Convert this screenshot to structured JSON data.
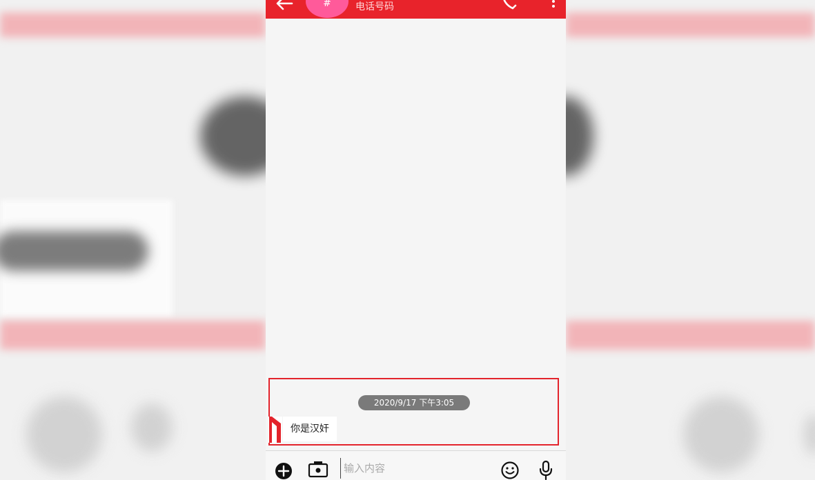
{
  "header": {
    "avatar_text": "#",
    "contact_subtitle": "电话号码"
  },
  "chat": {
    "messages": [
      {
        "timestamp": "2020/9/17 下午3:05",
        "text": "你是汉奸",
        "direction": "incoming"
      }
    ]
  },
  "composer": {
    "placeholder": "输入内容"
  },
  "colors": {
    "accent": "#e8232b",
    "avatar": "#ff5a9a",
    "highlight_border": "#e3232b",
    "timestamp_bg": "#7a7a7a"
  },
  "icons": {
    "back": "back-arrow-icon",
    "call": "phone-icon",
    "more": "more-vertical-icon",
    "add": "add-circle-icon",
    "camera": "camera-icon",
    "emoji": "emoji-icon",
    "mic": "microphone-icon"
  }
}
